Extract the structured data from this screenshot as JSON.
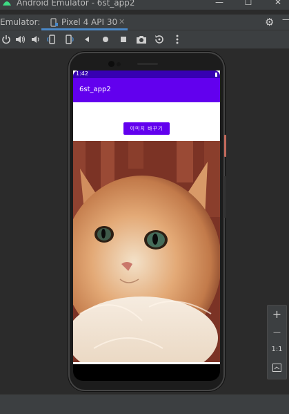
{
  "window": {
    "title": "Android Emulator - 6st_app2",
    "min_icon": "minimize-icon",
    "max_icon": "maximize-icon",
    "close_icon": "close-icon",
    "min_glyph": "—",
    "max_glyph": "☐",
    "close_glyph": "✕"
  },
  "tabbar": {
    "label": "Emulator:",
    "tab_label": "Pixel 4 API 30",
    "tab_close": "✕",
    "settings_icon": "gear-icon",
    "min_glyph": "—"
  },
  "toolbar": {
    "icons": [
      "power-icon",
      "volume-up-icon",
      "volume-down-icon",
      "rotate-left-icon",
      "rotate-right-icon",
      "back-icon",
      "home-icon",
      "overview-icon",
      "camera-icon",
      "reset-icon",
      "more-icon"
    ]
  },
  "device": {
    "status_time": "1:42",
    "app_title": "6st_app2",
    "button_label": "이미지 바꾸기",
    "image_icon": "cat-photo"
  },
  "zoom": {
    "plus": "+",
    "minus": "—",
    "one_to_one": "1:1",
    "fit_icon": "fit-screen-icon"
  },
  "colors": {
    "primary": "#6200ee",
    "primary_dark": "#3700b3",
    "accent_tab": "#4a88c7",
    "ide_bg": "#2b2b2b"
  }
}
